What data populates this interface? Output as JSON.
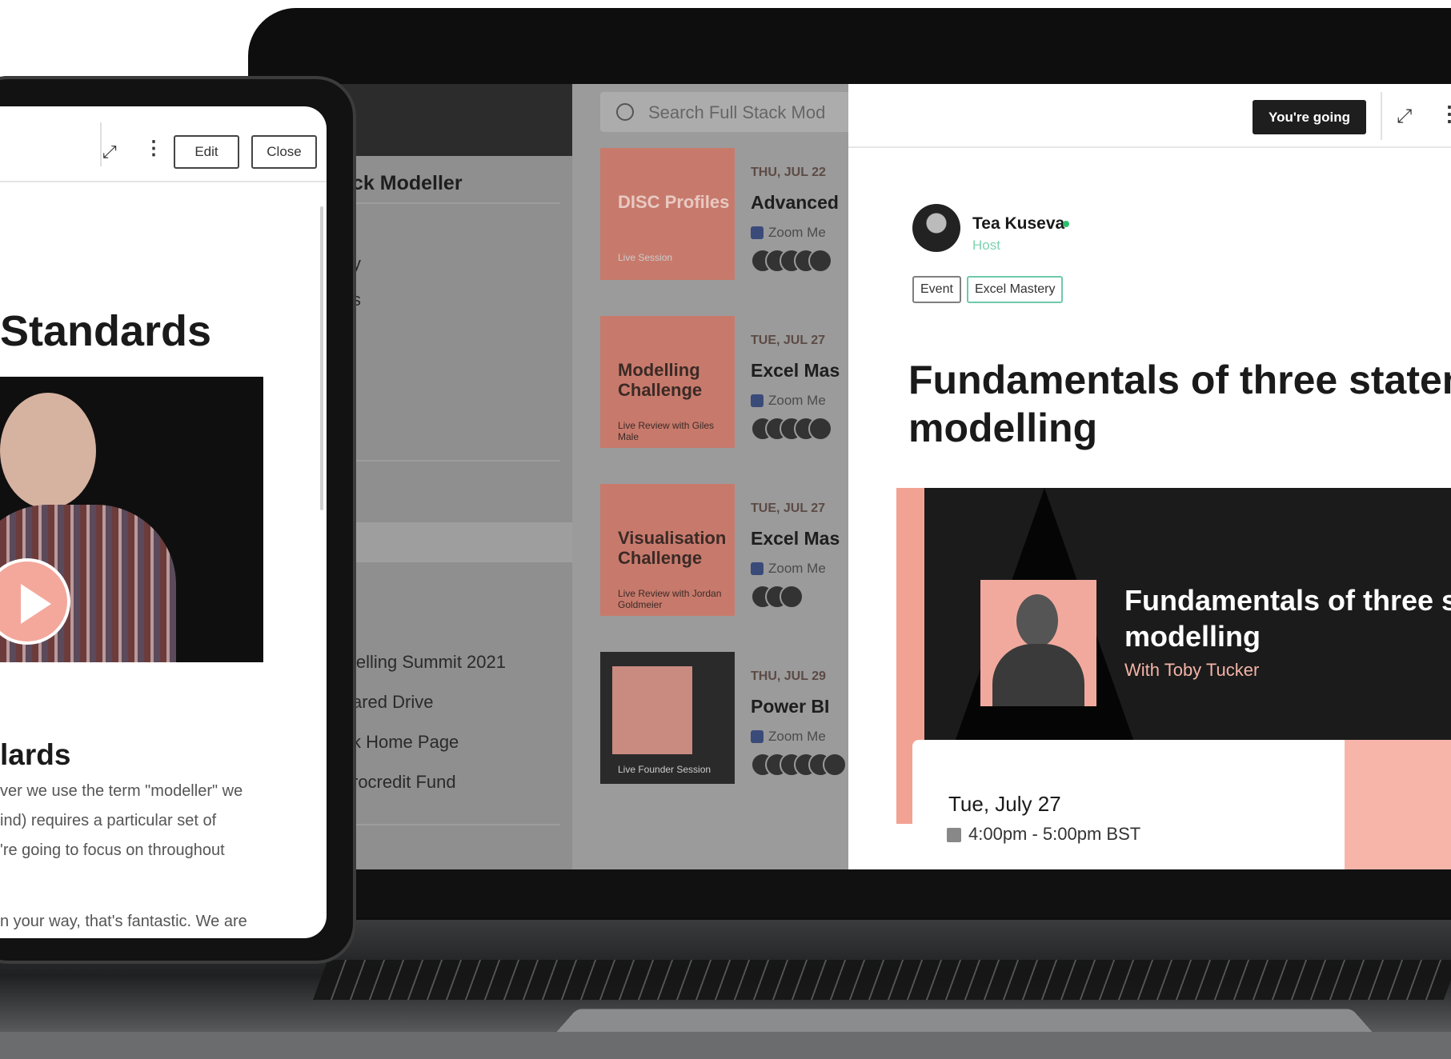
{
  "laptop": {
    "sidebar": {
      "app_title": "ck Modeller",
      "nav_items": [
        "y",
        "s",
        "lelling Summit 2021",
        "ared Drive",
        "k Home Page",
        "rocredit Fund"
      ]
    },
    "search": {
      "placeholder": "Search Full Stack Mod"
    },
    "events": [
      {
        "thumb_title": "DISC Profiles",
        "thumb_sub": "Live Session",
        "date": "THU, JUL 22",
        "title": "Advanced",
        "location": "Zoom Me"
      },
      {
        "thumb_title": "Modelling Challenge",
        "thumb_sub": "Live Review with Giles Male",
        "date": "TUE, JUL 27",
        "title": "Excel Mas",
        "location": "Zoom Me"
      },
      {
        "thumb_title": "Visualisation Challenge",
        "thumb_sub": "Live Review with Jordan Goldmeier",
        "date": "TUE, JUL 27",
        "title": "Excel Mas",
        "location": "Zoom Me"
      },
      {
        "thumb_title": "",
        "thumb_sub": "Live Founder Session",
        "date": "THU, JUL 29",
        "title": "Power BI",
        "location": "Zoom Me"
      }
    ],
    "detail": {
      "going_label": "You're going",
      "host_name": "Tea Kuseva",
      "host_role": "Host",
      "tags": [
        "Event",
        "Excel Mastery"
      ],
      "heading_line1": "Fundamentals of three statem",
      "heading_line2": "modelling",
      "banner_title_line1": "Fundamentals of three sta",
      "banner_title_line2": "modelling",
      "banner_with": "With Toby Tucker",
      "date": "Tue, July 27",
      "time": "4:00pm - 5:00pm BST"
    }
  },
  "tablet": {
    "edit_label": "Edit",
    "close_label": "Close",
    "title": "Standards",
    "subheading": "lards",
    "paragraph": [
      "ver we use the term \"modeller\" we",
      "ind) requires a particular set of",
      "'re going to focus on throughout",
      "n your way, that's fantastic. We are"
    ]
  },
  "colors": {
    "accent_pink": "#f2a293",
    "dark": "#1b1b1b",
    "online_green": "#2bbf6c"
  }
}
